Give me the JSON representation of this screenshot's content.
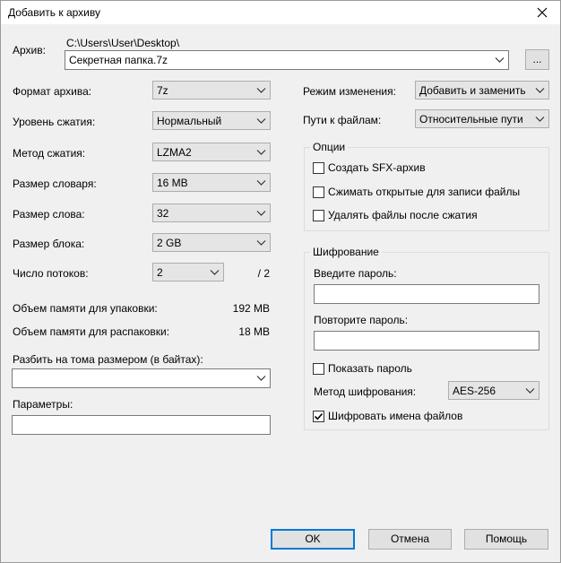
{
  "window": {
    "title": "Добавить к архиву"
  },
  "archive": {
    "label": "Архив:",
    "path": "C:\\Users\\User\\Desktop\\",
    "filename": "Секретная папка.7z",
    "browse_label": "..."
  },
  "left": {
    "format_label": "Формат архива:",
    "format_value": "7z",
    "level_label": "Уровень сжатия:",
    "level_value": "Нормальный",
    "method_label": "Метод сжатия:",
    "method_value": "LZMA2",
    "dict_label": "Размер словаря:",
    "dict_value": "16 MB",
    "word_label": "Размер слова:",
    "word_value": "32",
    "block_label": "Размер блока:",
    "block_value": "2 GB",
    "threads_label": "Число потоков:",
    "threads_value": "2",
    "threads_max": "/ 2",
    "mem_pack_label": "Объем памяти для упаковки:",
    "mem_pack_value": "192 MB",
    "mem_unpack_label": "Объем памяти для распаковки:",
    "mem_unpack_value": "18 MB",
    "split_label": "Разбить на тома размером (в байтах):",
    "split_value": "",
    "params_label": "Параметры:",
    "params_value": ""
  },
  "right": {
    "update_label": "Режим изменения:",
    "update_value": "Добавить и заменить",
    "paths_label": "Пути к файлам:",
    "paths_value": "Относительные пути",
    "options": {
      "title": "Опции",
      "items": [
        {
          "label": "Создать SFX-архив",
          "checked": false
        },
        {
          "label": "Сжимать открытые для записи файлы",
          "checked": false
        },
        {
          "label": "Удалять файлы после сжатия",
          "checked": false
        }
      ]
    },
    "encryption": {
      "title": "Шифрование",
      "password_label": "Введите пароль:",
      "password_value": "",
      "repeat_label": "Повторите пароль:",
      "repeat_value": "",
      "show_password_label": "Показать пароль",
      "show_password_checked": false,
      "method_label": "Метод шифрования:",
      "method_value": "AES-256",
      "encrypt_names_label": "Шифровать имена файлов",
      "encrypt_names_checked": true
    }
  },
  "buttons": {
    "ok": "OK",
    "cancel": "Отмена",
    "help": "Помощь"
  }
}
